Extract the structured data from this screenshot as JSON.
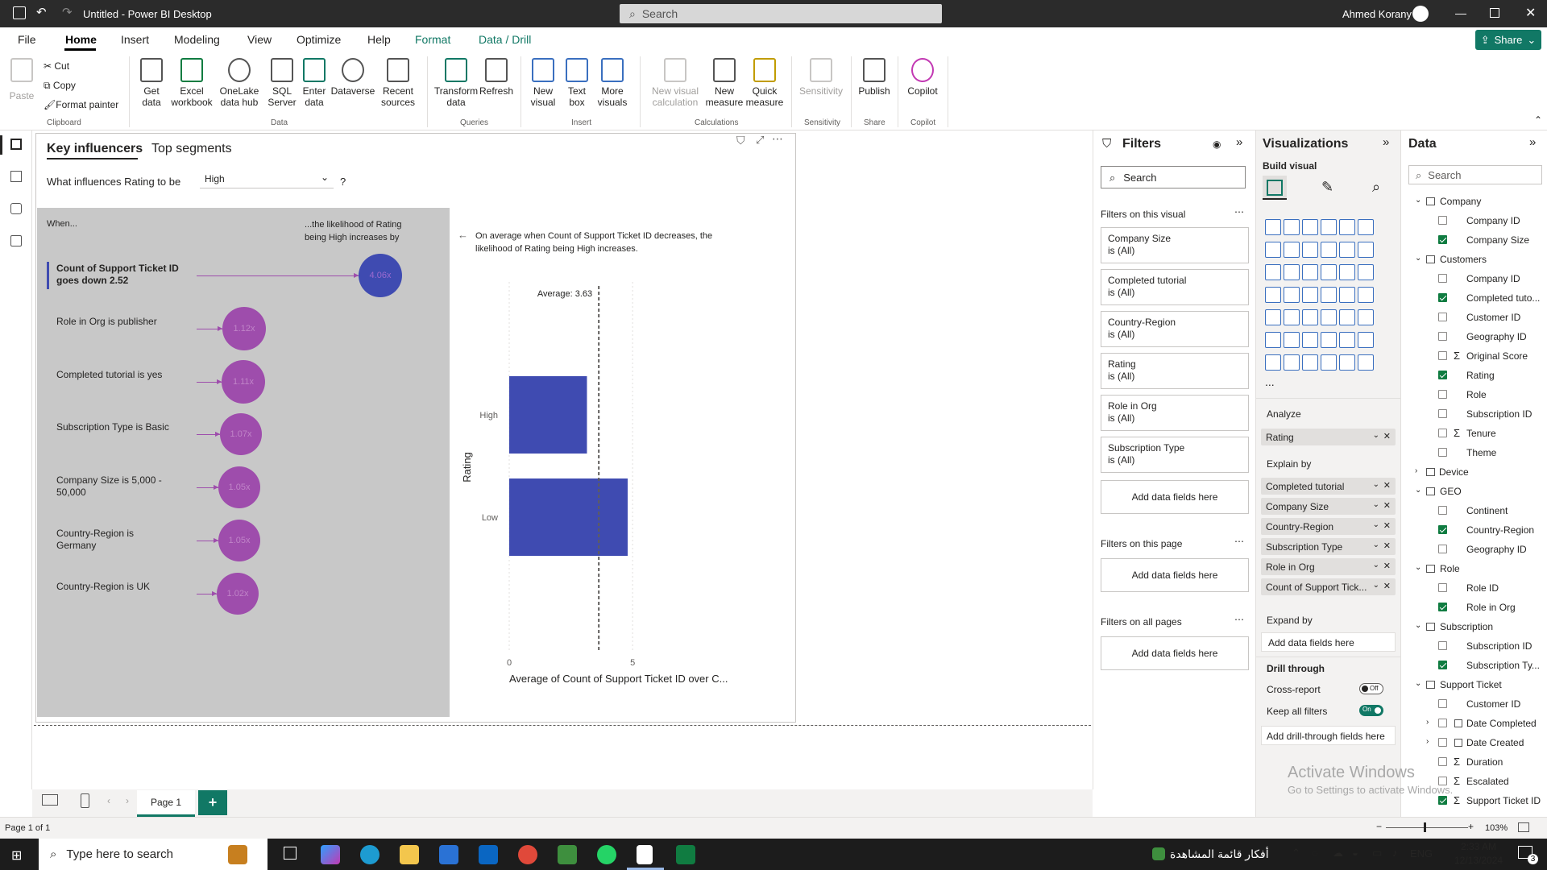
{
  "window": {
    "title": "Untitled - Power BI Desktop",
    "search_placeholder": "Search",
    "user": "Ahmed Korany",
    "share_label": "Share"
  },
  "menu": [
    "File",
    "Home",
    "Insert",
    "Modeling",
    "View",
    "Optimize",
    "Help",
    "Format",
    "Data / Drill"
  ],
  "ribbon": {
    "clipboard": {
      "paste": "Paste",
      "cut": "Cut",
      "copy": "Copy",
      "format_painter": "Format painter",
      "group": "Clipboard"
    },
    "data": {
      "get_data": "Get data",
      "excel": "Excel workbook",
      "onelake": "OneLake data hub",
      "sql": "SQL Server",
      "enter": "Enter data",
      "dataverse": "Dataverse",
      "recent": "Recent sources",
      "group": "Data"
    },
    "queries": {
      "transform": "Transform data",
      "refresh": "Refresh",
      "group": "Queries"
    },
    "insert": {
      "new_visual": "New visual",
      "text_box": "Text box",
      "more_visuals": "More visuals",
      "group": "Insert"
    },
    "calculations": {
      "new_visual_calc": "New visual calculation",
      "new_measure": "New measure",
      "quick_measure": "Quick measure",
      "group": "Calculations"
    },
    "sensitivity": {
      "label": "Sensitivity",
      "group": "Sensitivity"
    },
    "share": {
      "publish": "Publish",
      "group": "Share"
    },
    "copilot": {
      "label": "Copilot",
      "group": "Copilot"
    }
  },
  "visual": {
    "tabs": [
      "Key influencers",
      "Top segments"
    ],
    "question_prefix": "What influences Rating to be",
    "question_value": "High",
    "question_suffix": "?",
    "when_header": "When...",
    "likelihood_header": "...the likelihood of Rating being High increases by",
    "influencers": [
      {
        "label": "Count of Support Ticket ID goes down 2.52",
        "value": "4.06x",
        "multiplier": 4.06
      },
      {
        "label": "Role in Org is publisher",
        "value": "1.12x",
        "multiplier": 1.12
      },
      {
        "label": "Completed tutorial is yes",
        "value": "1.11x",
        "multiplier": 1.11
      },
      {
        "label": "Subscription Type is Basic",
        "value": "1.07x",
        "multiplier": 1.07
      },
      {
        "label": "Company Size is 5,000 - 50,000",
        "value": "1.05x",
        "multiplier": 1.05
      },
      {
        "label": "Country-Region is Germany",
        "value": "1.05x",
        "multiplier": 1.05
      },
      {
        "label": "Country-Region is UK",
        "value": "1.02x",
        "multiplier": 1.02
      }
    ],
    "detail_text": "On average when Count of Support Ticket ID decreases, the likelihood of Rating being High increases."
  },
  "chart_data": {
    "type": "bar",
    "orientation": "horizontal",
    "categories": [
      "High",
      "Low"
    ],
    "values": [
      3.15,
      4.8
    ],
    "xlabel": "Average of Count of Support Ticket ID over C...",
    "ylabel": "Rating",
    "xlim": [
      0,
      8
    ],
    "xticks": [
      "0",
      "5"
    ],
    "reference_line": {
      "label": "Average: 3.63",
      "value": 3.63
    },
    "color": "#3f4bb1"
  },
  "filters": {
    "title": "Filters",
    "search_placeholder": "Search",
    "on_visual_label": "Filters on this visual",
    "cards": [
      {
        "name": "Company Size",
        "state": "is (All)"
      },
      {
        "name": "Completed tutorial",
        "state": "is (All)"
      },
      {
        "name": "Country-Region",
        "state": "is (All)"
      },
      {
        "name": "Rating",
        "state": "is (All)"
      },
      {
        "name": "Role in Org",
        "state": "is (All)"
      },
      {
        "name": "Subscription Type",
        "state": "is (All)"
      }
    ],
    "add_fields": "Add data fields here",
    "on_page_label": "Filters on this page",
    "all_pages_label": "Filters on all pages"
  },
  "viz": {
    "title": "Visualizations",
    "build_visual": "Build visual",
    "more": "...",
    "analyze_label": "Analyze",
    "analyze_field": "Rating",
    "explain_label": "Explain by",
    "explain_fields": [
      "Completed tutorial",
      "Company Size",
      "Country-Region",
      "Subscription Type",
      "Role in Org",
      "Count of Support Tick..."
    ],
    "expand_label": "Expand by",
    "add_fields": "Add data fields here",
    "drill_label": "Drill through",
    "cross_report": "Cross-report",
    "cross_report_state": "Off",
    "keep_filters": "Keep all filters",
    "keep_filters_state": "On",
    "add_drill": "Add drill-through fields here"
  },
  "data_pane": {
    "title": "Data",
    "search_placeholder": "Search",
    "tables": [
      {
        "name": "Company",
        "fields": [
          {
            "n": "Company ID",
            "c": false
          },
          {
            "n": "Company Size",
            "c": true
          }
        ]
      },
      {
        "name": "Customers",
        "fields": [
          {
            "n": "Company ID",
            "c": false
          },
          {
            "n": "Completed tuto...",
            "c": true
          },
          {
            "n": "Customer ID",
            "c": false
          },
          {
            "n": "Geography ID",
            "c": false
          },
          {
            "n": "Original Score",
            "c": false,
            "sigma": true
          },
          {
            "n": "Rating",
            "c": true
          },
          {
            "n": "Role",
            "c": false
          },
          {
            "n": "Subscription ID",
            "c": false
          },
          {
            "n": "Tenure",
            "c": false,
            "sigma": true
          },
          {
            "n": "Theme",
            "c": false
          }
        ]
      },
      {
        "name": "Device",
        "fields": [],
        "collapsed": true
      },
      {
        "name": "GEO",
        "fields": [
          {
            "n": "Continent",
            "c": false
          },
          {
            "n": "Country-Region",
            "c": true
          },
          {
            "n": "Geography ID",
            "c": false
          }
        ]
      },
      {
        "name": "Role",
        "fields": [
          {
            "n": "Role ID",
            "c": false
          },
          {
            "n": "Role in Org",
            "c": true
          }
        ]
      },
      {
        "name": "Subscription",
        "fields": [
          {
            "n": "Subscription ID",
            "c": false
          },
          {
            "n": "Subscription Ty...",
            "c": true
          }
        ]
      },
      {
        "name": "Support Ticket",
        "fields": [
          {
            "n": "Customer ID",
            "c": false
          },
          {
            "n": "Date Completed",
            "c": false,
            "cal": true
          },
          {
            "n": "Date Created",
            "c": false,
            "cal": true
          },
          {
            "n": "Duration",
            "c": false,
            "sigma": true
          },
          {
            "n": "Escalated",
            "c": false,
            "sigma": true
          },
          {
            "n": "Support Ticket ID",
            "c": true,
            "sigma": true
          }
        ]
      }
    ]
  },
  "pages": {
    "tab": "Page 1",
    "add": "+"
  },
  "status": {
    "page": "Page 1 of 1",
    "zoom": "103%"
  },
  "watermark": {
    "line1": "Activate Windows",
    "line2": "Go to Settings to activate Windows."
  },
  "taskbar": {
    "search": "Type here to search",
    "news": "أفكار قائمة المشاهدة",
    "lang": "ENG",
    "time": "2:33 AM",
    "date": "12/13/2024",
    "badge": "3"
  }
}
